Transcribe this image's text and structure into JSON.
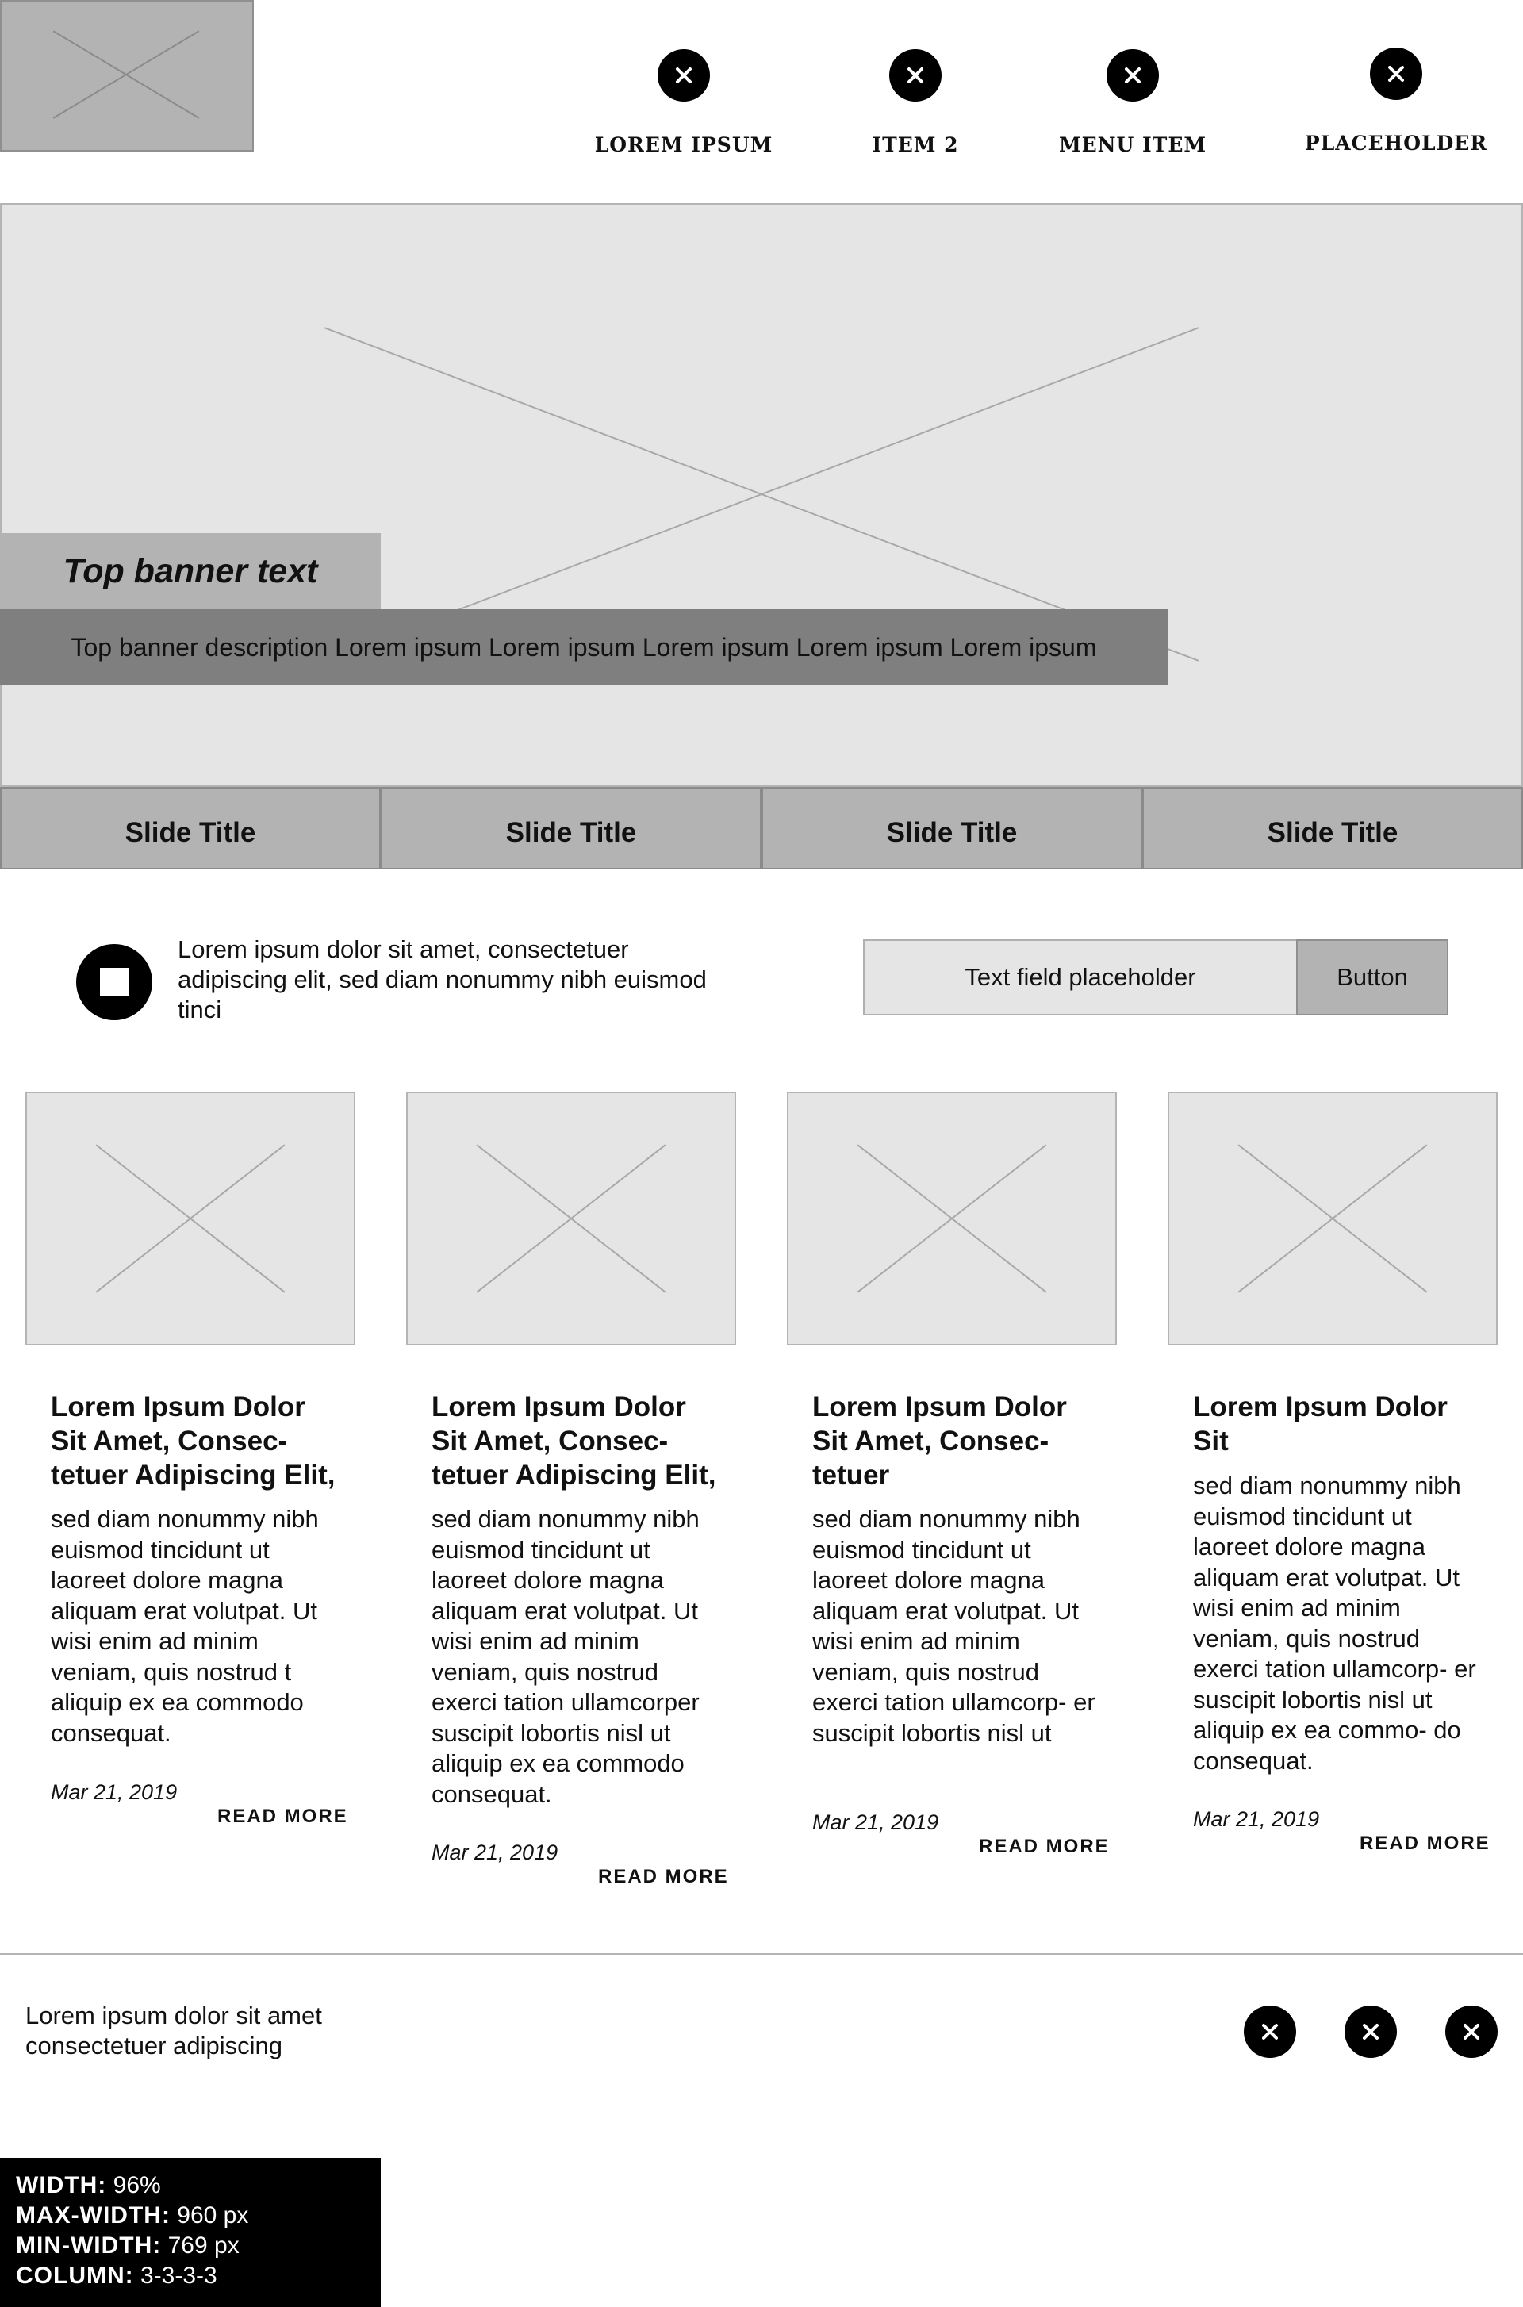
{
  "nav": {
    "items": [
      {
        "label": "LOREM IPSUM",
        "icon": "close-icon"
      },
      {
        "label": "ITEM 2",
        "icon": "close-icon"
      },
      {
        "label": "MENU ITEM",
        "icon": "close-icon"
      },
      {
        "label": "PLACEHOLDER",
        "icon": "close-icon"
      }
    ]
  },
  "hero": {
    "banner_title": "Top banner text",
    "banner_description": "Top banner description Lorem ipsum Lorem ipsum Lorem ipsum Lorem ipsum Lorem ipsum"
  },
  "slides": [
    "Slide Title",
    "Slide Title",
    "Slide Title",
    "Slide Title"
  ],
  "intro": {
    "icon": "stop-icon",
    "text": "Lorem ipsum dolor sit amet, consectetuer adipiscing elit, sed diam nonummy nibh euismod tinci"
  },
  "search": {
    "placeholder": "Text field placeholder",
    "button_label": "Button"
  },
  "cards": [
    {
      "title": "Lorem Ipsum Dolor Sit Amet, Consec- tetuer Adipiscing Elit,",
      "body": "sed diam nonummy nibh euismod tincidunt ut laoreet dolore magna aliquam erat volutpat. Ut wisi enim ad minim veniam, quis nostrud t aliquip ex ea commodo consequat.",
      "date": "Mar 21, 2019",
      "read_more": "READ MORE"
    },
    {
      "title": "Lorem Ipsum Dolor Sit Amet, Consec- tetuer Adipiscing Elit,",
      "body": "sed diam nonummy nibh euismod tincidunt ut laoreet dolore magna aliquam erat volutpat. Ut wisi enim ad minim veniam, quis nostrud exerci tation ullamcorper suscipit lobortis nisl ut aliquip ex ea commodo consequat.",
      "date": "Mar 21, 2019",
      "read_more": "READ MORE"
    },
    {
      "title": "Lorem Ipsum Dolor Sit Amet, Consec- tetuer",
      "body": "sed diam nonummy nibh euismod tincidunt ut laoreet dolore magna aliquam erat volutpat. Ut wisi enim ad minim veniam, quis nostrud exerci tation ullamcorp- er suscipit lobortis nisl ut",
      "date": "Mar 21, 2019",
      "read_more": "READ MORE"
    },
    {
      "title": "Lorem Ipsum Dolor Sit",
      "body": "sed diam nonummy nibh euismod tincidunt ut laoreet dolore magna aliquam erat volutpat. Ut wisi enim ad minim veniam, quis nostrud exerci tation ullamcorp- er suscipit lobortis nisl ut aliquip ex ea commo- do consequat.",
      "date": "Mar 21, 2019",
      "read_more": "READ MORE"
    }
  ],
  "footer": {
    "text": "Lorem ipsum dolor sit amet consectetuer adipiscing",
    "social_icons": [
      "close-icon",
      "close-icon",
      "close-icon"
    ]
  },
  "spec": [
    {
      "key": "WIDTH:",
      "value": "96%"
    },
    {
      "key": "MAX-WIDTH:",
      "value": "960 px"
    },
    {
      "key": "MIN-WIDTH:",
      "value": "769 px"
    },
    {
      "key": "COLUMN:",
      "value": "3-3-3-3"
    }
  ],
  "colors": {
    "placeholder_fill": "#e5e5e5",
    "placeholder_border": "#b4b4b4",
    "mid_gray": "#b3b3b3",
    "dark_gray": "#7f7f7f",
    "black": "#000000"
  }
}
